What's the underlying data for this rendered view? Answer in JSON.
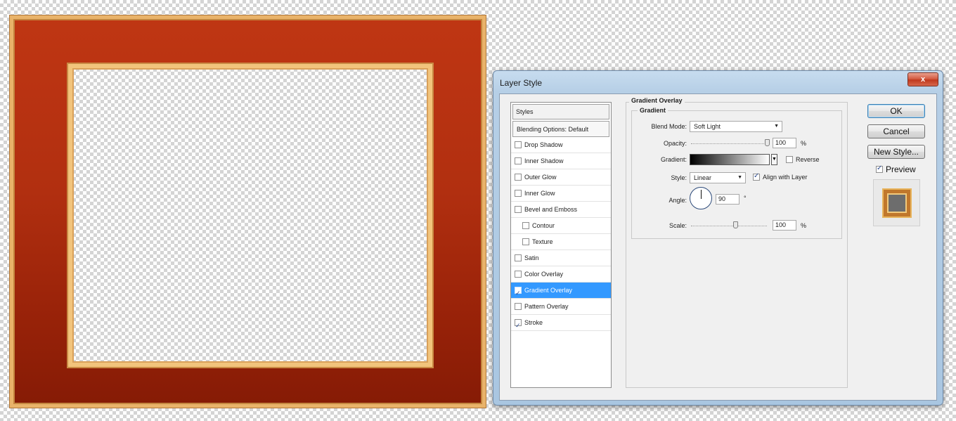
{
  "dialog": {
    "title": "Layer Style",
    "close_label": "x"
  },
  "styles_list": {
    "header": "Styles",
    "blending": "Blending Options: Default",
    "items": [
      {
        "label": "Drop Shadow",
        "checked": false,
        "indent": false,
        "selected": false
      },
      {
        "label": "Inner Shadow",
        "checked": false,
        "indent": false,
        "selected": false
      },
      {
        "label": "Outer Glow",
        "checked": false,
        "indent": false,
        "selected": false
      },
      {
        "label": "Inner Glow",
        "checked": false,
        "indent": false,
        "selected": false
      },
      {
        "label": "Bevel and Emboss",
        "checked": false,
        "indent": false,
        "selected": false
      },
      {
        "label": "Contour",
        "checked": false,
        "indent": true,
        "selected": false
      },
      {
        "label": "Texture",
        "checked": false,
        "indent": true,
        "selected": false
      },
      {
        "label": "Satin",
        "checked": false,
        "indent": false,
        "selected": false
      },
      {
        "label": "Color Overlay",
        "checked": false,
        "indent": false,
        "selected": false
      },
      {
        "label": "Gradient Overlay",
        "checked": true,
        "indent": false,
        "selected": true
      },
      {
        "label": "Pattern Overlay",
        "checked": false,
        "indent": false,
        "selected": false
      },
      {
        "label": "Stroke",
        "checked": true,
        "indent": false,
        "selected": false
      }
    ]
  },
  "gradient_overlay": {
    "group_title": "Gradient Overlay",
    "subgroup_title": "Gradient",
    "blend_mode_label": "Blend Mode:",
    "blend_mode_value": "Soft Light",
    "opacity_label": "Opacity:",
    "opacity_value": "100",
    "opacity_unit": "%",
    "gradient_label": "Gradient:",
    "reverse_label": "Reverse",
    "reverse_checked": false,
    "style_label": "Style:",
    "style_value": "Linear",
    "align_label": "Align with Layer",
    "align_checked": true,
    "angle_label": "Angle:",
    "angle_value": "90",
    "angle_unit": "°",
    "scale_label": "Scale:",
    "scale_value": "100",
    "scale_unit": "%"
  },
  "buttons": {
    "ok": "OK",
    "cancel": "Cancel",
    "new_style": "New Style...",
    "preview_label": "Preview",
    "preview_checked": true
  },
  "colors": {
    "frame_red": "#b12f10",
    "frame_gold": "#e9b36a",
    "selection_blue": "#3399ff"
  }
}
